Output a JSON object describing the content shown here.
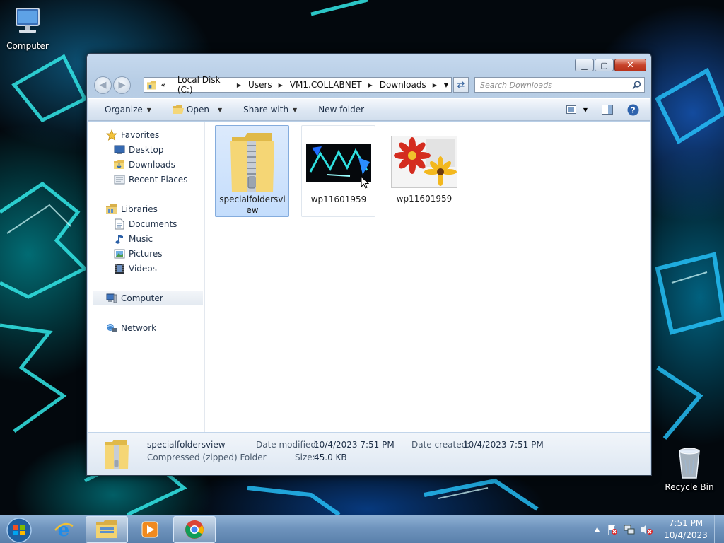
{
  "desktop": {
    "icons": [
      {
        "label": "Computer",
        "icon": "computer-icon"
      },
      {
        "label": "Recycle Bin",
        "icon": "recycle-bin-icon"
      }
    ]
  },
  "window": {
    "controls": {
      "minimize": "minimize",
      "maximize": "maximize",
      "close": "close"
    },
    "address": {
      "prefix": "«",
      "crumbs": [
        "Local Disk (C:)",
        "Users",
        "VM1.COLLABNET",
        "Downloads"
      ]
    },
    "search": {
      "placeholder": "Search Downloads"
    },
    "toolbar": {
      "organize": "Organize",
      "open": "Open",
      "share_with": "Share with",
      "new_folder": "New folder"
    },
    "navpane": {
      "favorites": {
        "label": "Favorites",
        "items": [
          "Desktop",
          "Downloads",
          "Recent Places"
        ]
      },
      "libraries": {
        "label": "Libraries",
        "items": [
          "Documents",
          "Music",
          "Pictures",
          "Videos"
        ]
      },
      "computer": "Computer",
      "network": "Network"
    },
    "files": [
      {
        "name": "specialfoldersview",
        "type": "zip-folder",
        "selected": true
      },
      {
        "name": "wp11601959",
        "type": "image-wallpaper",
        "selected": false
      },
      {
        "name": "wp11601959",
        "type": "image-flowers",
        "selected": false
      }
    ],
    "details": {
      "name": "specialfoldersview",
      "type": "Compressed (zipped) Folder",
      "date_modified_label": "Date modified:",
      "date_modified": "10/4/2023 7:51 PM",
      "size_label": "Size:",
      "size": "45.0 KB",
      "date_created_label": "Date created:",
      "date_created": "10/4/2023 7:51 PM"
    }
  },
  "taskbar": {
    "apps": [
      "start-orb",
      "internet-explorer",
      "windows-explorer",
      "media-player",
      "chrome"
    ],
    "clock": {
      "time": "7:51 PM",
      "date": "10/4/2023"
    }
  }
}
